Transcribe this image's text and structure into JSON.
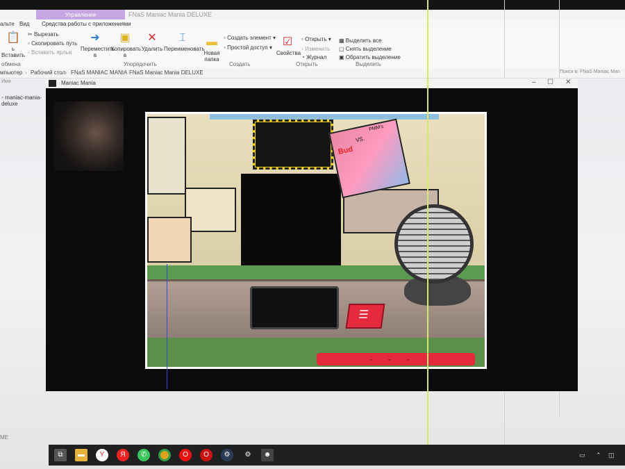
{
  "explorer": {
    "context_tab": "Управление",
    "window_title": "FNaS Maniac Mania DELUXE",
    "tabs": [
      "альте",
      "Вид",
      "Средства работы с приложениями"
    ],
    "ribbon": {
      "paste": "ь Вставить",
      "cut": "Вырезать",
      "copy_path": "Скопировать путь",
      "paste_shortcut": "Вставить ярлык",
      "buffer_group": "обмена",
      "move": "Переместить в",
      "copy": "Копировать в",
      "delete": "Удалить",
      "rename": "Переименовать",
      "organize_group": "Упорядочить",
      "new_folder": "Новая папка",
      "create_item": "Создать элемент",
      "easy_access": "Простой доступ",
      "create_group": "Создать",
      "properties": "Свойства",
      "open": "Открыть",
      "edit": "Изменить",
      "history": "Журнал",
      "open_group": "Открыть",
      "select_all": "Выделить все",
      "select_none": "Снять выделение",
      "invert_selection": "Обратить выделение",
      "select_group": "Выделить"
    },
    "address": {
      "crumbs": [
        "мпьютер",
        "Рабочий стол",
        "FNaS MANIAC MANIA",
        "FNaS Maniac Mania DELUXE"
      ],
      "search_placeholder": "Поиск в: FNaS Maniac Man"
    },
    "column_header": "Имя",
    "nav_item": "maniac-mania-deluxe"
  },
  "game": {
    "title": "Maniac Mania",
    "poster_bud": "Bud",
    "poster_vs": "VS.",
    "poster_pmm": "PMM's"
  },
  "taskbar": {
    "left_label": "ME",
    "apps": [
      "task-view",
      "file-explorer",
      "yandex-browser",
      "yandex",
      "whatsapp",
      "chrome",
      "opera",
      "opera-gx",
      "steam",
      "settings",
      "maniac-mania"
    ],
    "tray_keyboard": "▭"
  }
}
